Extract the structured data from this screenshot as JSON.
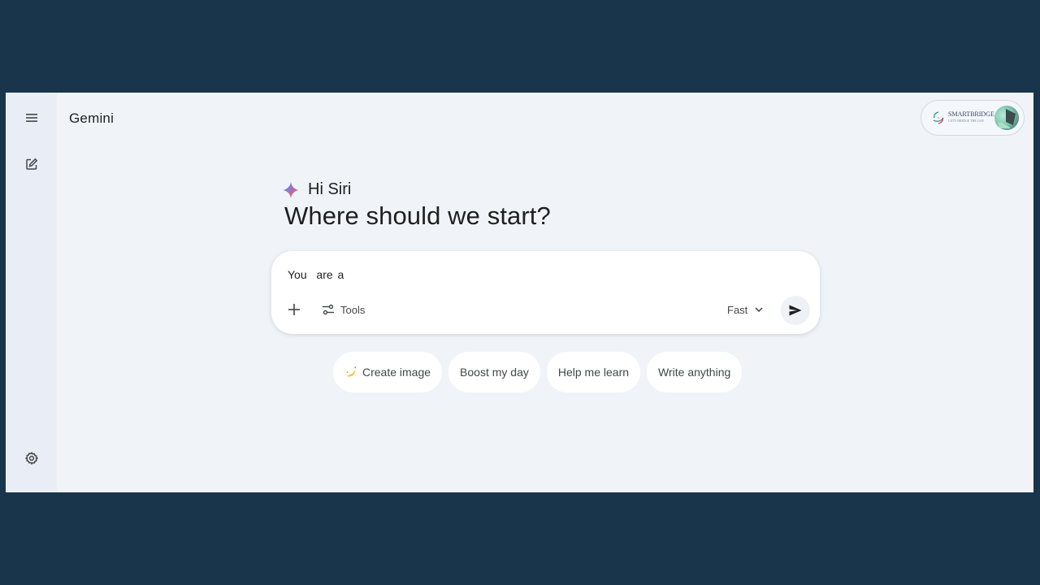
{
  "app": {
    "title": "Gemini"
  },
  "sidebar": {
    "icons": [
      "menu-icon",
      "new-chat-icon",
      "settings-icon"
    ]
  },
  "account": {
    "brand": "SMARTBRIDGE",
    "brand_tagline": "LET'S BRIDGE THE GAP"
  },
  "greeting": {
    "name_line": "Hi Siri",
    "headline": "Where should we start?"
  },
  "prompt": {
    "value": "You  are a",
    "add_icon": "plus-icon",
    "tools_label": "Tools",
    "tools_icon": "sliders-icon",
    "mode_label": "Fast",
    "mode_icon": "chevron-down-icon",
    "send_icon": "send-icon"
  },
  "suggestions": [
    {
      "label": "Create image",
      "icon": "banana-icon"
    },
    {
      "label": "Boost my day"
    },
    {
      "label": "Help me learn"
    },
    {
      "label": "Write anything"
    }
  ],
  "colors": {
    "backdrop": "#18354c",
    "app_background": "#f0f4f9",
    "rail_background": "#e9eef6",
    "text_primary": "#1f1f1f",
    "text_secondary": "#444746"
  }
}
